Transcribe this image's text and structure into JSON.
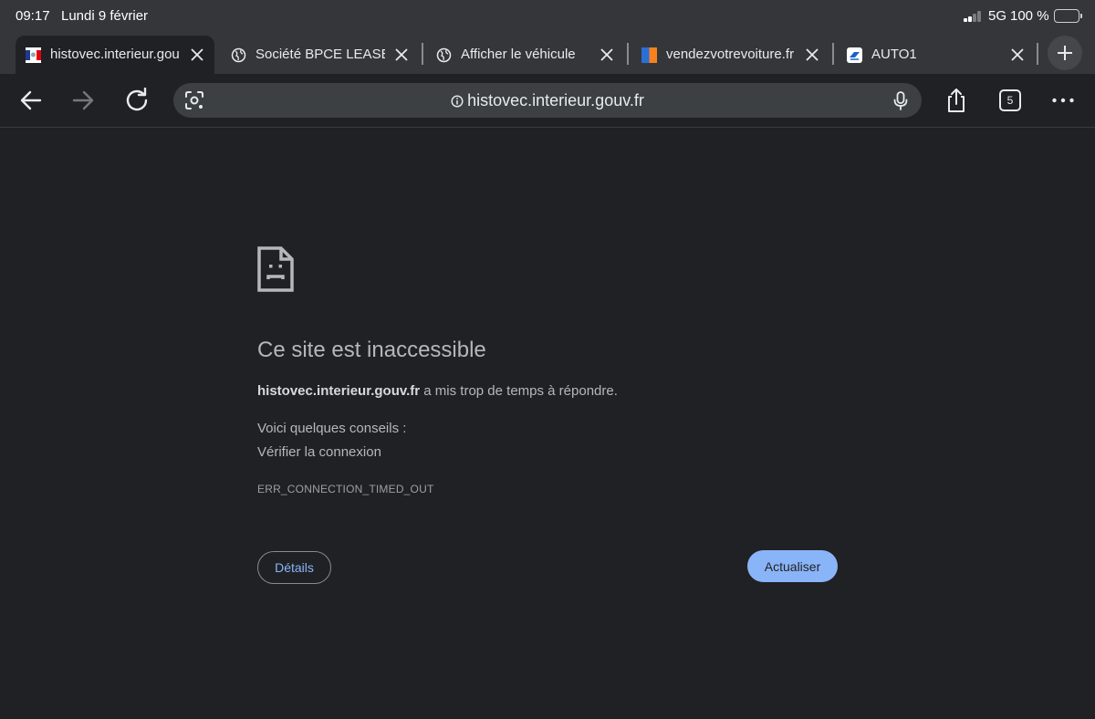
{
  "status_bar": {
    "time": "09:17",
    "date": "Lundi 9 février",
    "network": "5G",
    "battery": "100 %"
  },
  "tabs": [
    {
      "title": "histovec.interieur.gouv.fr",
      "favicon": "french-republic-favicon",
      "active": true
    },
    {
      "title": "Société BPCE LEASE",
      "favicon": "globe-icon",
      "active": false
    },
    {
      "title": "Afficher le véhicule",
      "favicon": "globe-icon",
      "active": false
    },
    {
      "title": "vendezvotrevoiture.fr",
      "favicon": "vendezvotrevoiture-favicon",
      "active": false
    },
    {
      "title": "AUTO1",
      "favicon": "auto1-favicon",
      "active": false
    }
  ],
  "toolbar": {
    "url": "histovec.interieur.gouv.fr",
    "tab_count": "5"
  },
  "error": {
    "title": "Ce site est inaccessible",
    "host": "histovec.interieur.gouv.fr",
    "message": " a mis trop de temps à répondre.",
    "tips_title": "Voici quelques conseils :",
    "tip_1": "Vérifier la connexion",
    "code": "ERR_CONNECTION_TIMED_OUT",
    "details_button": "Détails",
    "reload_button": "Actualiser"
  },
  "colors": {
    "page_bg": "#202124",
    "chrome_bg": "#35363a",
    "accent": "#8ab4f8"
  }
}
